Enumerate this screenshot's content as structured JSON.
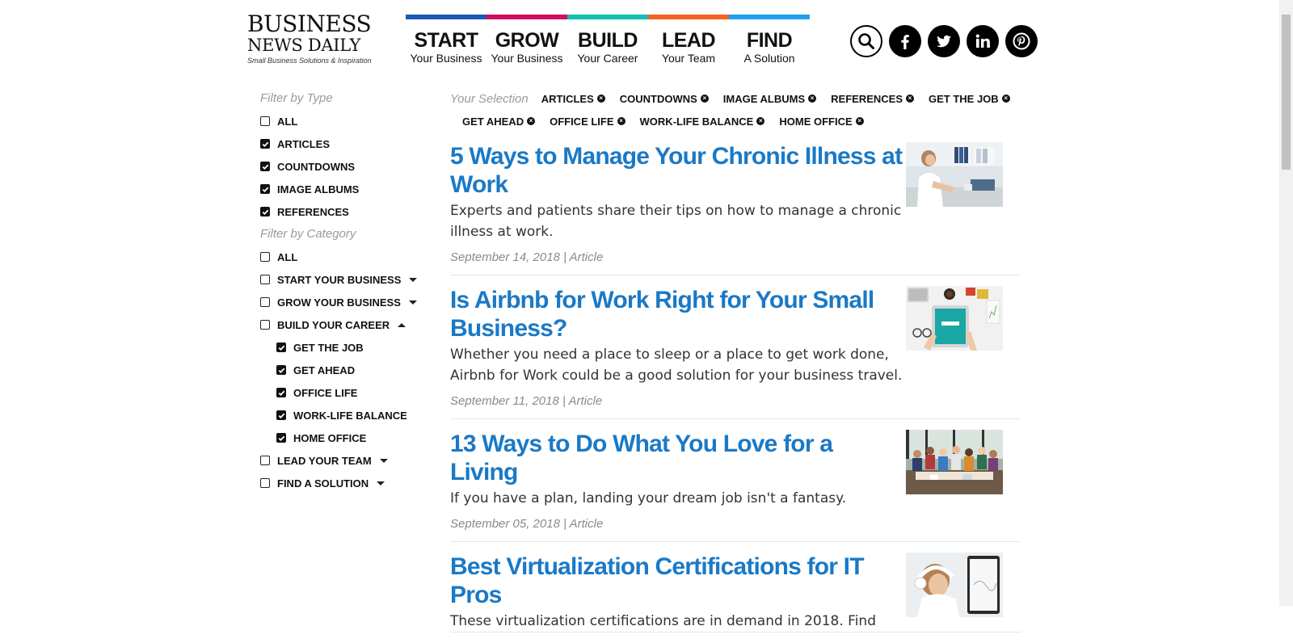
{
  "logo": {
    "line1": "BUSINESS",
    "line2": "NEWS DAILY",
    "tagline": "Small Business Solutions & Inspiration"
  },
  "nav": [
    {
      "main": "START",
      "sub": "Your Business",
      "color": "#1e57b8"
    },
    {
      "main": "GROW",
      "sub": "Your Business",
      "color": "#d0105f"
    },
    {
      "main": "BUILD",
      "sub": "Your Career",
      "color": "#15c0b0"
    },
    {
      "main": "LEAD",
      "sub": "Your Team",
      "color": "#f26522"
    },
    {
      "main": "FIND",
      "sub": "A Solution",
      "color": "#1fa0f0"
    }
  ],
  "social": [
    "search-icon",
    "facebook-icon",
    "twitter-icon",
    "linkedin-icon",
    "pinterest-icon"
  ],
  "sidebar": {
    "type_title": "Filter by Type",
    "type_items": [
      {
        "label": "ALL",
        "checked": false
      },
      {
        "label": "ARTICLES",
        "checked": true
      },
      {
        "label": "COUNTDOWNS",
        "checked": true
      },
      {
        "label": "IMAGE ALBUMS",
        "checked": true
      },
      {
        "label": "REFERENCES",
        "checked": true
      }
    ],
    "category_title": "Filter by Category",
    "category_items": [
      {
        "label": "ALL",
        "checked": false
      },
      {
        "label": "START YOUR BUSINESS",
        "checked": false,
        "caret": "down"
      },
      {
        "label": "GROW YOUR BUSINESS",
        "checked": false,
        "caret": "down"
      },
      {
        "label": "BUILD YOUR CAREER",
        "checked": false,
        "caret": "up"
      },
      {
        "label": "GET THE JOB",
        "checked": true,
        "sub": true
      },
      {
        "label": "GET AHEAD",
        "checked": true,
        "sub": true
      },
      {
        "label": "OFFICE LIFE",
        "checked": true,
        "sub": true
      },
      {
        "label": "WORK-LIFE BALANCE",
        "checked": true,
        "sub": true
      },
      {
        "label": "HOME OFFICE",
        "checked": true,
        "sub": true
      },
      {
        "label": "LEAD YOUR TEAM",
        "checked": false,
        "caret": "down"
      },
      {
        "label": "FIND A SOLUTION",
        "checked": false,
        "caret": "down"
      }
    ]
  },
  "selection": {
    "label": "Your Selection",
    "row1": [
      "ARTICLES",
      "COUNTDOWNS",
      "IMAGE ALBUMS",
      "REFERENCES",
      "GET THE JOB"
    ],
    "row2": [
      "GET AHEAD",
      "OFFICE LIFE",
      "WORK-LIFE BALANCE",
      "HOME OFFICE"
    ]
  },
  "articles": [
    {
      "title": "5 Ways to Manage Your Chronic Illness at Work",
      "desc": "Experts and patients share their tips on how to manage a chronic illness at work.",
      "meta": "September 14, 2018 | Article",
      "thumb": "office-woman"
    },
    {
      "title": "Is Airbnb for Work Right for Your Small Business?",
      "desc": "Whether you need a place to sleep or a place to get work done, Airbnb for Work could be a good solution for your business travel.",
      "meta": "September 11, 2018 | Article",
      "thumb": "tablet-desk"
    },
    {
      "title": "13 Ways to Do What You Love for a Living",
      "desc": "If you have a plan, landing your dream job isn't a fantasy.",
      "meta": "September 05, 2018 | Article",
      "thumb": "team-group"
    },
    {
      "title": "Best Virtualization Certifications for IT Pros",
      "desc": "These virtualization certifications are in demand in 2018. Find",
      "meta": "",
      "thumb": "headphones-woman"
    }
  ]
}
